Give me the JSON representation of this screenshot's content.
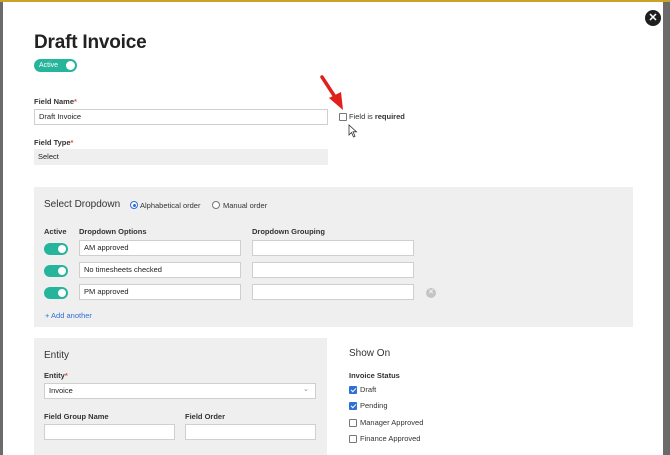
{
  "modal": {
    "title": "Draft Invoice",
    "active_label": "Active",
    "close_icon": "close-icon"
  },
  "field_name": {
    "label": "Field Name",
    "required_mark": "*",
    "value": "Draft Invoice"
  },
  "field_required": {
    "label_prefix": "Field is ",
    "label_bold": "required",
    "checked": false
  },
  "field_type": {
    "label": "Field Type",
    "required_mark": "*",
    "value": "Select"
  },
  "select_dropdown": {
    "title": "Select Dropdown",
    "sort_options": [
      {
        "label": "Alphabetical order",
        "selected": true
      },
      {
        "label": "Manual order",
        "selected": false
      }
    ],
    "col_active": "Active",
    "col_options": "Dropdown Options",
    "col_grouping": "Dropdown Grouping",
    "rows": [
      {
        "active": true,
        "option": "AM approved",
        "grouping": ""
      },
      {
        "active": true,
        "option": "No timesheets checked",
        "grouping": ""
      },
      {
        "active": true,
        "option": "PM approved",
        "grouping": ""
      }
    ],
    "add_another": "+ Add another"
  },
  "entity": {
    "title": "Entity",
    "entity_label": "Entity",
    "required_mark": "*",
    "entity_value": "Invoice",
    "group_name_label": "Field Group Name",
    "group_name_value": "",
    "order_label": "Field Order",
    "order_value": ""
  },
  "show_on": {
    "title": "Show On",
    "status_label": "Invoice Status",
    "statuses": [
      {
        "label": "Draft",
        "checked": true
      },
      {
        "label": "Pending",
        "checked": true
      },
      {
        "label": "Manager Approved",
        "checked": false
      },
      {
        "label": "Finance Approved",
        "checked": false
      }
    ]
  },
  "colors": {
    "accent_toggle": "#26b49b",
    "link": "#2f6fd6",
    "annotation_arrow": "#e0201b"
  }
}
